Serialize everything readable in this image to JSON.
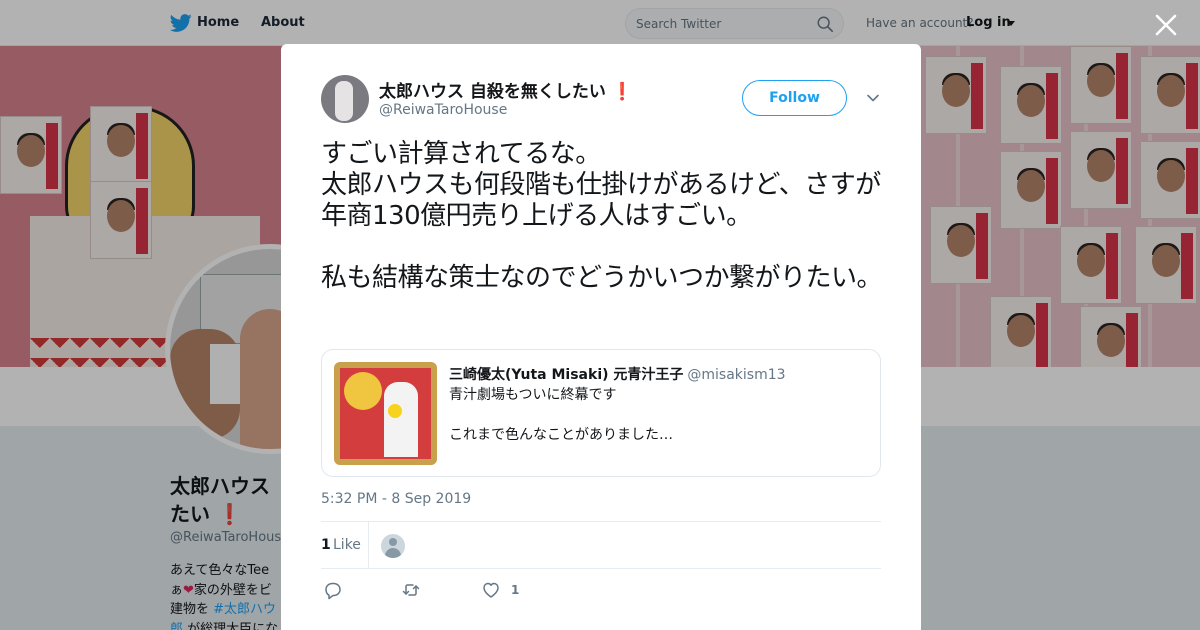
{
  "nav": {
    "home_label": "Home",
    "about_label": "About",
    "search_placeholder": "Search Twitter",
    "account_prompt": "Have an account?",
    "login_label": "Log in"
  },
  "profile": {
    "name_line1": "太郎ハウス",
    "name_line2": "たい",
    "name_mark": "❗",
    "handle": "@ReiwaTaroHouse",
    "bio_line1": "あえて色々なTee",
    "bio_line2_prefix": "ぁ",
    "bio_heart": "❤",
    "bio_line2_rest": "家の外壁をビ",
    "bio_line3_prefix": "建物を",
    "bio_hashtag": "#太郎ハウ",
    "bio_line4_hashtag": "郎",
    "bio_line4_rest": "が総理大臣にな"
  },
  "tweet": {
    "author_name": "太郎ハウス 自殺を無くしたい",
    "author_mark": "❗",
    "author_handle": "@ReiwaTaroHouse",
    "follow_label": "Follow",
    "text": "すごい計算されてるな。\n太郎ハウスも何段階も仕掛けがあるけど、さすが年商130億円売り上げる人はすごい。\n\n私も結構な策士なのでどうかいつか繋がりたい。",
    "timestamp": "5:32 PM - 8 Sep 2019",
    "like_count": "1",
    "like_label": "Like",
    "action_like_count": "1"
  },
  "quote": {
    "author_name": "三崎優太(Yuta Misaki) 元青汁王子",
    "author_handle": "@misakism13",
    "text": "青汁劇場もついに終幕です\n\nこれまで色んなことがありました…"
  },
  "colors": {
    "accent": "#1da1f2",
    "exclaim": "#d9263a",
    "heart": "#e0245e"
  },
  "icons": [
    "twitter-bird-icon",
    "search-icon",
    "caret-down-icon",
    "close-icon",
    "chevron-down-icon",
    "reply-icon",
    "retweet-icon",
    "heart-icon",
    "default-avatar-icon"
  ]
}
